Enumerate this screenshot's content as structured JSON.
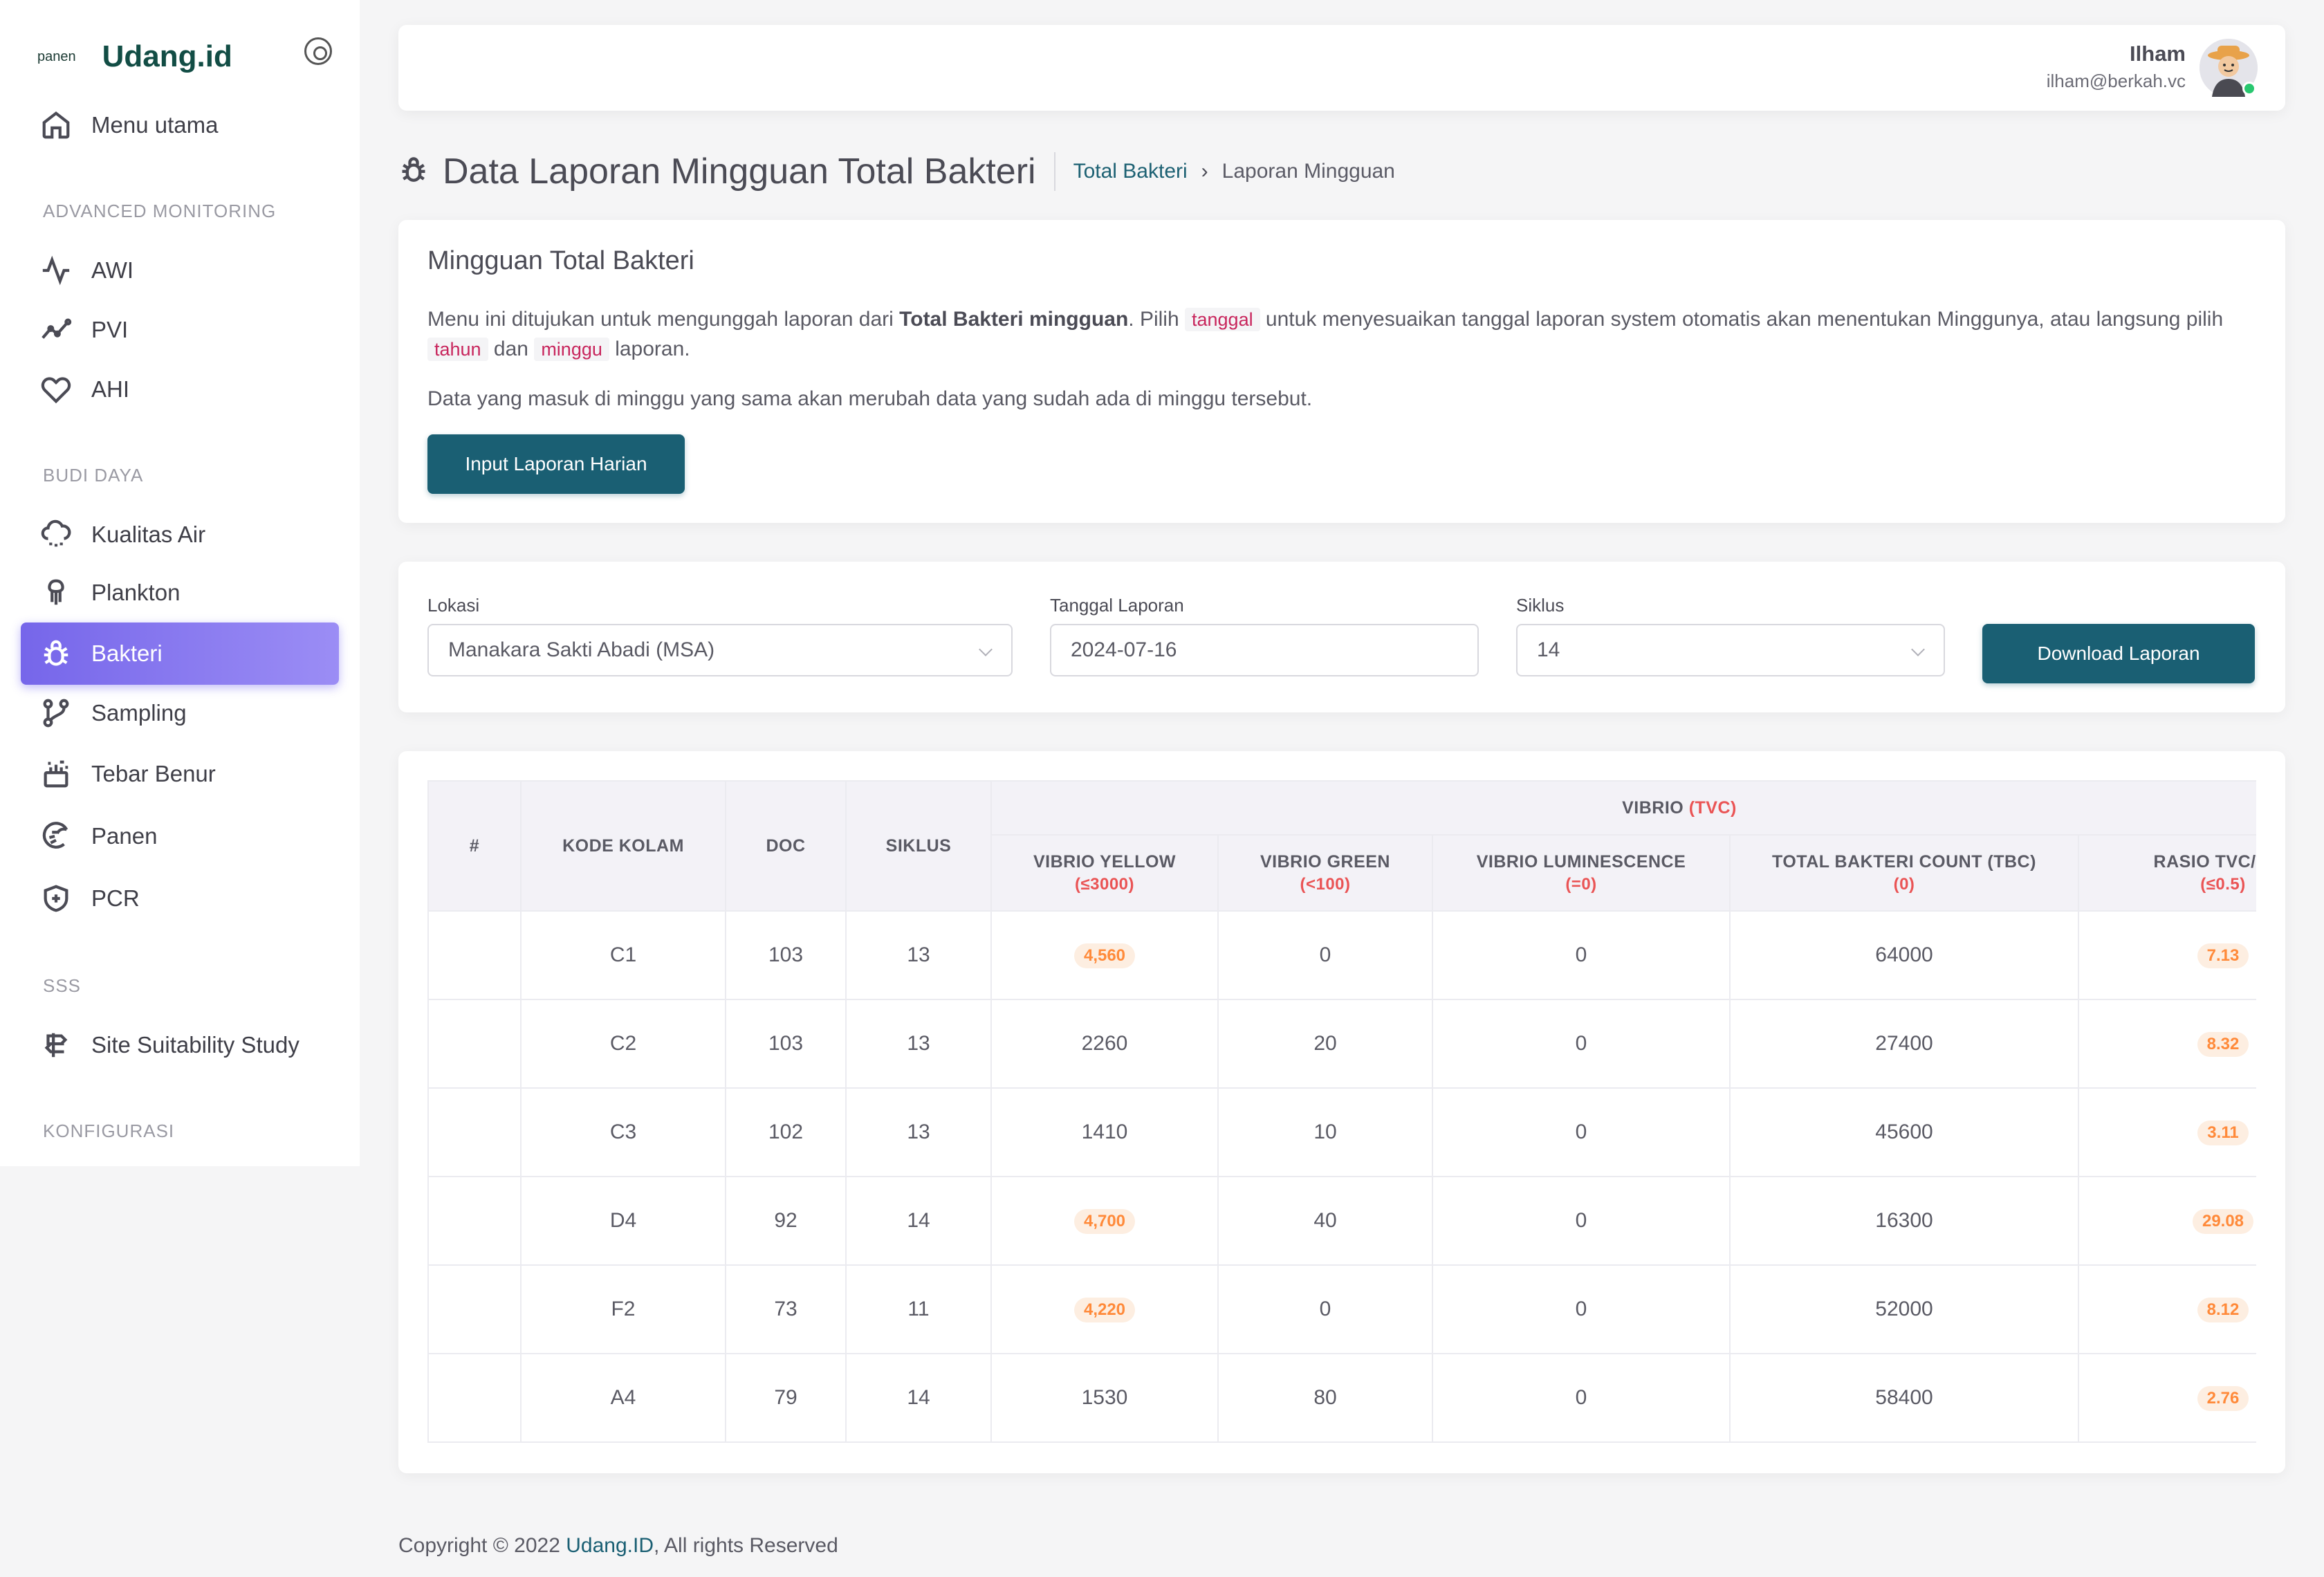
{
  "brand": {
    "small": "panen",
    "name": "Udang.id"
  },
  "sidebar": {
    "main": {
      "label": "Menu utama"
    },
    "sections": [
      {
        "title": "ADVANCED MONITORING"
      },
      {
        "title": "BUDI DAYA"
      },
      {
        "title": "SSS"
      },
      {
        "title": "KONFIGURASI"
      }
    ],
    "items": [
      {
        "label": "AWI"
      },
      {
        "label": "PVI"
      },
      {
        "label": "AHI"
      },
      {
        "label": "Kualitas Air"
      },
      {
        "label": "Plankton"
      },
      {
        "label": "Bakteri"
      },
      {
        "label": "Sampling"
      },
      {
        "label": "Tebar Benur"
      },
      {
        "label": "Panen"
      },
      {
        "label": "PCR"
      },
      {
        "label": "Site Suitability Study"
      }
    ]
  },
  "user": {
    "name": "Ilham",
    "email": "ilham@berkah.vc"
  },
  "page": {
    "title": "Data Laporan Mingguan Total Bakteri",
    "breadcrumb": {
      "link": "Total Bakteri",
      "sep": "›",
      "current": "Laporan Mingguan"
    }
  },
  "intro": {
    "title": "Mingguan Total Bakteri",
    "desc_a": "Menu ini ditujukan untuk mengunggah laporan dari ",
    "desc_bold": "Total Bakteri mingguan",
    "desc_b": ". Pilih ",
    "code_tanggal": "tanggal",
    "desc_c": " untuk menyesuaikan tanggal laporan system otomatis akan menentukan Minggunya, atau langsung pilih ",
    "code_tahun": "tahun",
    "desc_d": " dan ",
    "code_minggu": "minggu",
    "desc_e": " laporan.",
    "note": "Data yang masuk di minggu yang sama akan merubah data yang sudah ada di minggu tersebut.",
    "button": "Input Laporan Harian"
  },
  "filters": {
    "lokasi": {
      "label": "Lokasi",
      "value": "Manakara Sakti Abadi (MSA)"
    },
    "tanggal": {
      "label": "Tanggal Laporan",
      "value": "2024-07-16"
    },
    "siklus": {
      "label": "Siklus",
      "value": "14"
    },
    "download": "Download Laporan"
  },
  "table": {
    "headers": {
      "no": "#",
      "kode": "KODE KOLAM",
      "doc": "DOC",
      "siklus": "SIKLUS",
      "group": "VIBRIO",
      "group_unit": "(TVC)",
      "yellow": "VIBRIO YELLOW",
      "yellow_lim": "(≤3000)",
      "green": "VIBRIO GREEN",
      "green_lim": "(<100)",
      "lumi": "VIBRIO LUMINESCENCE",
      "lumi_lim": "(=0)",
      "tbc": "TOTAL BAKTERI COUNT (TBC)",
      "tbc_lim": "(0)",
      "rasio": "RASIO TVC/TBC",
      "rasio_lim": "(≤0.5)"
    },
    "rows": [
      {
        "kode": "C1",
        "doc": "103",
        "siklus": "13",
        "yellow": "4,560",
        "yellow_flag": true,
        "green": "0",
        "lumi": "0",
        "tbc": "64000",
        "rasio": "7.13"
      },
      {
        "kode": "C2",
        "doc": "103",
        "siklus": "13",
        "yellow": "2260",
        "yellow_flag": false,
        "green": "20",
        "lumi": "0",
        "tbc": "27400",
        "rasio": "8.32"
      },
      {
        "kode": "C3",
        "doc": "102",
        "siklus": "13",
        "yellow": "1410",
        "yellow_flag": false,
        "green": "10",
        "lumi": "0",
        "tbc": "45600",
        "rasio": "3.11"
      },
      {
        "kode": "D4",
        "doc": "92",
        "siklus": "14",
        "yellow": "4,700",
        "yellow_flag": true,
        "green": "40",
        "lumi": "0",
        "tbc": "16300",
        "rasio": "29.08"
      },
      {
        "kode": "F2",
        "doc": "73",
        "siklus": "11",
        "yellow": "4,220",
        "yellow_flag": true,
        "green": "0",
        "lumi": "0",
        "tbc": "52000",
        "rasio": "8.12"
      },
      {
        "kode": "A4",
        "doc": "79",
        "siklus": "14",
        "yellow": "1530",
        "yellow_flag": false,
        "green": "80",
        "lumi": "0",
        "tbc": "58400",
        "rasio": "2.76"
      }
    ]
  },
  "footer": {
    "prefix": "Copyright © 2022 ",
    "link": "Udang.ID",
    "suffix": ", All rights Reserved"
  },
  "colors": {
    "primary": "#1a5f73",
    "active_nav": "#7666ea",
    "warning_pill": "#ff8a3a",
    "danger": "#ea5455"
  }
}
